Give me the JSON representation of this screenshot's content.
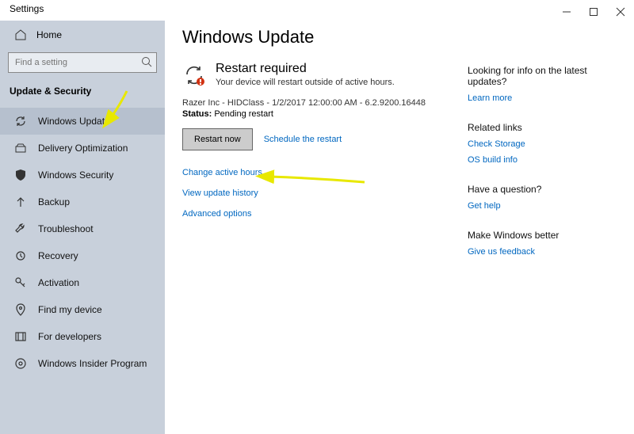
{
  "window": {
    "title": "Settings"
  },
  "sidebar": {
    "home": "Home",
    "search_placeholder": "Find a setting",
    "category": "Update & Security",
    "items": [
      {
        "label": "Windows Update"
      },
      {
        "label": "Delivery Optimization"
      },
      {
        "label": "Windows Security"
      },
      {
        "label": "Backup"
      },
      {
        "label": "Troubleshoot"
      },
      {
        "label": "Recovery"
      },
      {
        "label": "Activation"
      },
      {
        "label": "Find my device"
      },
      {
        "label": "For developers"
      },
      {
        "label": "Windows Insider Program"
      }
    ]
  },
  "main": {
    "page_title": "Windows Update",
    "restart_heading": "Restart required",
    "restart_sub": "Your device will restart outside of active hours.",
    "update_line": "Razer Inc - HIDClass - 1/2/2017 12:00:00 AM - 6.2.9200.16448",
    "status_label": "Status:",
    "status_value": "Pending restart",
    "restart_btn": "Restart now",
    "schedule_link": "Schedule the restart",
    "links": {
      "change_hours": "Change active hours",
      "view_history": "View update history",
      "advanced": "Advanced options"
    }
  },
  "aside": {
    "info_head": "Looking for info on the latest updates?",
    "info_link": "Learn more",
    "related_head": "Related links",
    "related_links": [
      "Check Storage",
      "OS build info"
    ],
    "question_head": "Have a question?",
    "question_link": "Get help",
    "better_head": "Make Windows better",
    "better_link": "Give us feedback"
  }
}
